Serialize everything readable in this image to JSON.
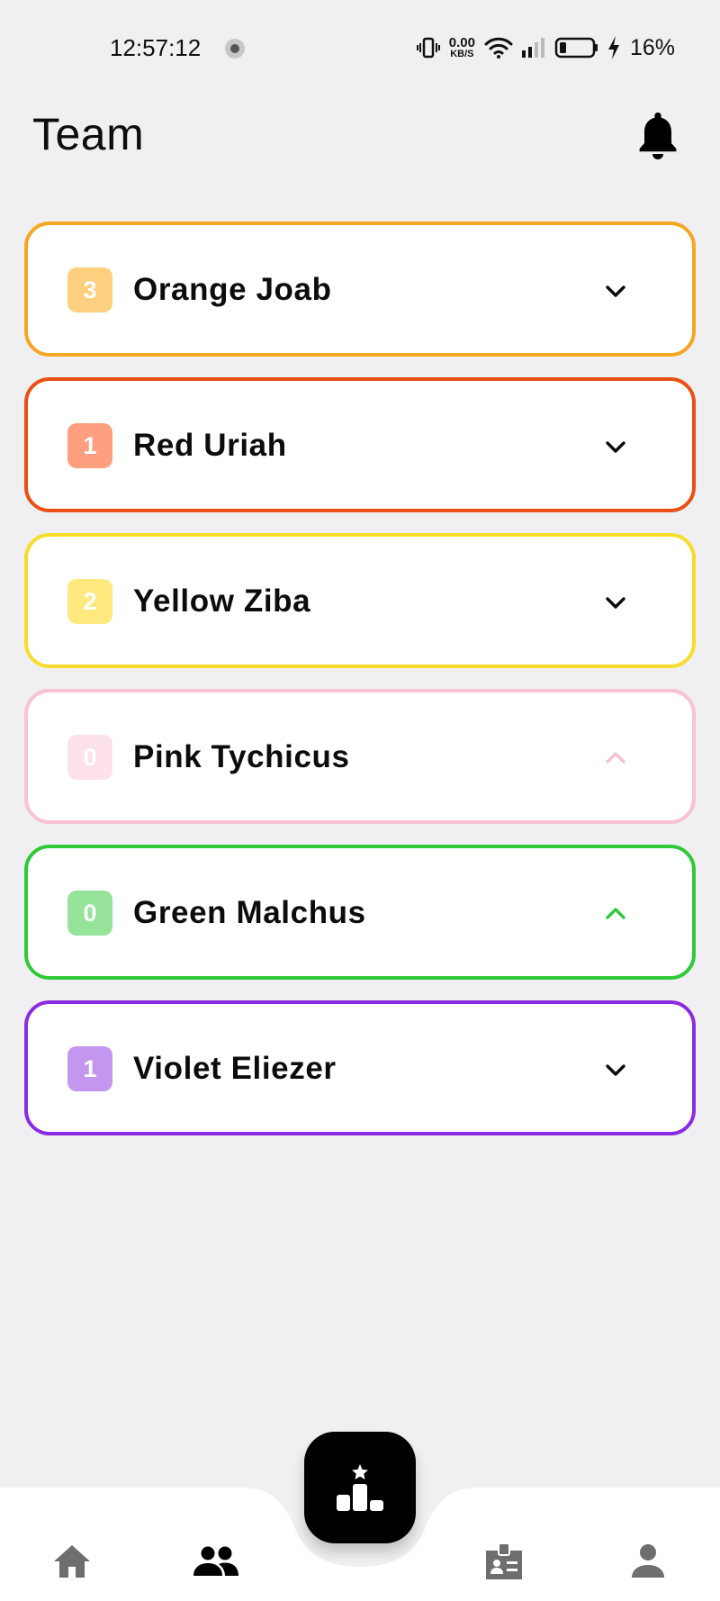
{
  "status_bar": {
    "time": "12:57:12",
    "net_speed_value": "0.00",
    "net_speed_unit": "KB/S",
    "battery_percent": "16%"
  },
  "header": {
    "title": "Team",
    "notification_icon": "bell-icon"
  },
  "teams": [
    {
      "name": "Orange Joab",
      "count": "3",
      "color": "#f5a623",
      "badge_color": "#fdd07f",
      "expanded": false
    },
    {
      "name": "Red Uriah",
      "count": "1",
      "color": "#ea4f14",
      "badge_color": "#fea07f",
      "expanded": false
    },
    {
      "name": "Yellow Ziba",
      "count": "2",
      "color": "#f8dc2a",
      "badge_color": "#ffe97f",
      "expanded": false
    },
    {
      "name": "Pink Tychicus",
      "count": "0",
      "color": "#f7c2d2",
      "badge_color": "#fde2ea",
      "expanded": true
    },
    {
      "name": "Green Malchus",
      "count": "0",
      "color": "#2fc93a",
      "badge_color": "#95e49a",
      "expanded": true
    },
    {
      "name": "Violet Eliezer",
      "count": "1",
      "color": "#8a2be2",
      "badge_color": "#c396f0",
      "expanded": false
    }
  ],
  "bottom_nav": {
    "items": [
      {
        "icon": "home-icon",
        "active": false
      },
      {
        "icon": "team-icon",
        "active": true
      },
      {
        "icon": "leaderboard-icon",
        "active": false
      },
      {
        "icon": "id-card-icon",
        "active": false
      },
      {
        "icon": "profile-icon",
        "active": false
      }
    ]
  }
}
